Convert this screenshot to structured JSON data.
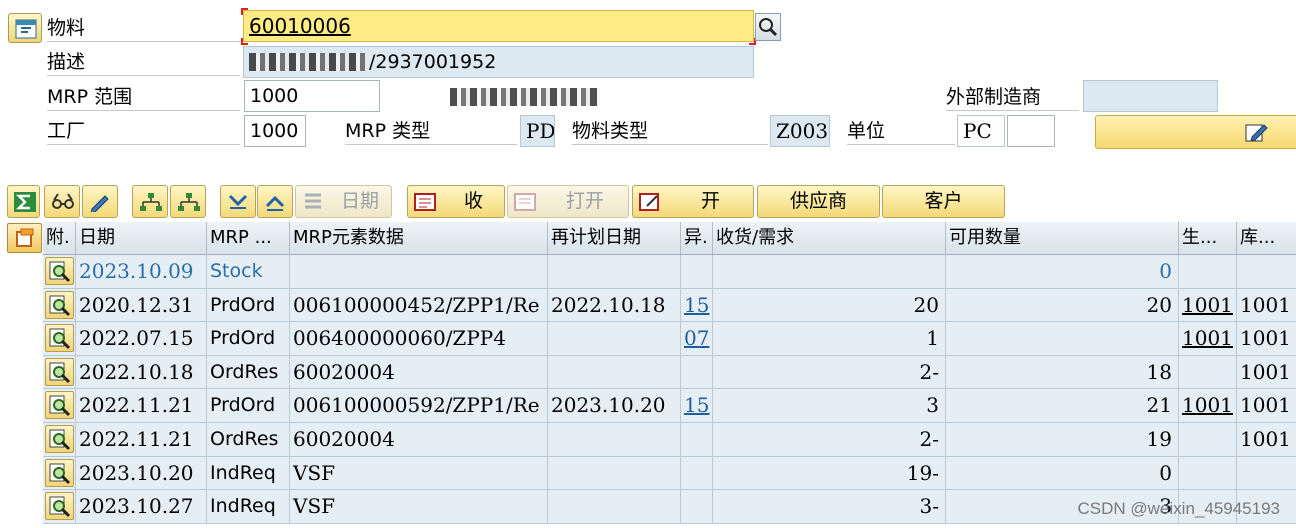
{
  "header": {
    "material_label": "物料",
    "material_value": "60010006",
    "desc_label": "描述",
    "desc_value": "/2937001952",
    "mrp_area_label": "MRP 范围",
    "mrp_area_value": "1000",
    "ext_mfr_label": "外部制造商",
    "ext_mfr_value": "",
    "plant_label": "工厂",
    "plant_value": "1000",
    "mrp_type_label": "MRP 类型",
    "mrp_type_value": "PD",
    "material_type_label": "物料类型",
    "material_type_value": "Z003",
    "unit_label": "单位",
    "unit_value": "PC"
  },
  "toolbar": {
    "date_label": "日期",
    "receive_label": "收",
    "open_label": "打开",
    "open2_label": "开",
    "vendor_label": "供应商",
    "customer_label": "客户"
  },
  "table": {
    "headers": [
      "附.",
      "日期",
      "MRP ...",
      "MRP元素数据",
      "再计划日期",
      "异.",
      "收货/需求",
      "可用数量",
      "生...",
      "库..."
    ],
    "rows": [
      {
        "date": "2023.10.09",
        "mrp": "Stock",
        "data": "",
        "resched": "",
        "exc": "",
        "rcpt": "",
        "avail": "0",
        "prod": "",
        "stor": ""
      },
      {
        "date": "2020.12.31",
        "mrp": "PrdOrd",
        "data": "006100000452/ZPP1/Re",
        "resched": "2022.10.18",
        "exc": "15",
        "rcpt": "20",
        "avail": "20",
        "prod": "1001",
        "stor": "1001"
      },
      {
        "date": "2022.07.15",
        "mrp": "PrdOrd",
        "data": "006400000060/ZPP4",
        "resched": "",
        "exc": "07",
        "rcpt": "1",
        "avail": "",
        "prod": "1001",
        "stor": "1001"
      },
      {
        "date": "2022.10.18",
        "mrp": "OrdRes",
        "data": "60020004",
        "resched": "",
        "exc": "",
        "rcpt": "2-",
        "avail": "18",
        "prod": "",
        "stor": "1001"
      },
      {
        "date": "2022.11.21",
        "mrp": "PrdOrd",
        "data": "006100000592/ZPP1/Re",
        "resched": "2023.10.20",
        "exc": "15",
        "rcpt": "3",
        "avail": "21",
        "prod": "1001",
        "stor": "1001"
      },
      {
        "date": "2022.11.21",
        "mrp": "OrdRes",
        "data": "60020004",
        "resched": "",
        "exc": "",
        "rcpt": "2-",
        "avail": "19",
        "prod": "",
        "stor": "1001"
      },
      {
        "date": "2023.10.20",
        "mrp": "IndReq",
        "data": "VSF",
        "resched": "",
        "exc": "",
        "rcpt": "19-",
        "avail": "0",
        "prod": "",
        "stor": ""
      },
      {
        "date": "2023.10.27",
        "mrp": "IndReq",
        "data": "VSF",
        "resched": "",
        "exc": "",
        "rcpt": "3-",
        "avail": "3",
        "prod": "",
        "stor": ""
      }
    ]
  },
  "watermark": "CSDN @weixin_45945193",
  "colors": {
    "button_yellow": "#f4d978",
    "field_focus": "#ffec86",
    "row_blue": "#e6eef5",
    "link_blue": "#1f5e9e"
  }
}
